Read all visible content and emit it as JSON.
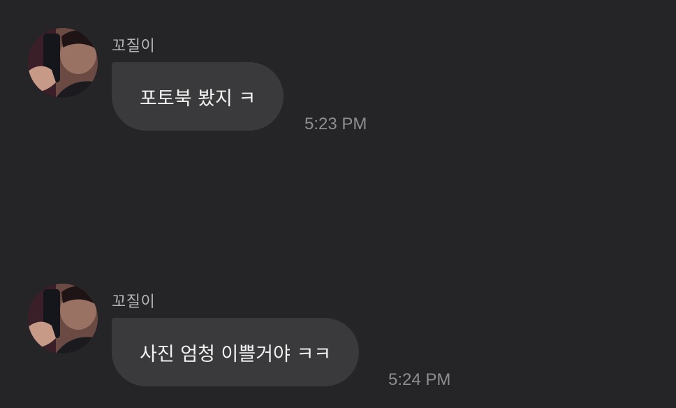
{
  "messages": [
    {
      "sender": "꼬질이",
      "text": "포토북 봤지 ㅋ",
      "time": "5:23 PM"
    },
    {
      "sender": "꼬질이",
      "text": "사진 엄청 이쁠거야 ㅋㅋ",
      "time": "5:24 PM"
    }
  ],
  "colors": {
    "background": "#252527",
    "bubble": "#3a3a3c",
    "message_text": "#f2f2f2",
    "sender_text": "#b6b6b8",
    "timestamp_text": "#8e8e91"
  }
}
